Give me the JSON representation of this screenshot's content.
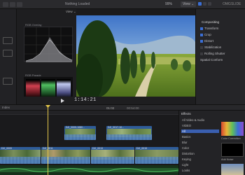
{
  "toolbar": {
    "library_title": "Nothing Loaded",
    "zoom": "99%",
    "view_menu": "View ⌄",
    "badge": "OMGSLIDE"
  },
  "scopes": {
    "view_label": "View ⌄",
    "rgb_overlay_label": "RGB Overlay",
    "rgb_parade_label": "RGB Parade",
    "parade": [
      "Red",
      "Green",
      "Blue"
    ]
  },
  "viewer": {
    "timecode": "1:14:21"
  },
  "inspector": {
    "section": "Compositing",
    "rows": [
      {
        "label": "Transform",
        "checked": true
      },
      {
        "label": "Crop",
        "checked": true
      },
      {
        "label": "Distort",
        "checked": true
      },
      {
        "label": "Stabilization",
        "checked": false
      },
      {
        "label": "Rolling Shutter",
        "checked": false
      },
      {
        "label": "Spatial Conform",
        "checked": false
      }
    ]
  },
  "timeline": {
    "index_label": "Index",
    "duration": "01:02",
    "total": "00:54:00",
    "clips": [
      {
        "label": "DJI_0009-1080...",
        "lane": "upper"
      },
      {
        "label": "DJI_0017-10...",
        "lane": "upper"
      },
      {
        "label": "DJI_0009",
        "lane": "main"
      },
      {
        "label": "DJI_0011",
        "lane": "main"
      },
      {
        "label": "DJI_0013",
        "lane": "main"
      },
      {
        "label": "DJI_0015",
        "lane": "main"
      }
    ]
  },
  "effects": {
    "header": "Effects",
    "categories": [
      "All Video & Audio",
      "VIDEO",
      "All",
      "Basics",
      "Blur",
      "Color",
      "Distortion",
      "Keying",
      "Light",
      "Looks"
    ],
    "selected_index": 2,
    "items": [
      "Color Correction",
      "Add Noise"
    ]
  },
  "colors": {
    "accent": "#3b6fd6",
    "playhead": "#e6c84a",
    "clip_blue": "#2f5d9a"
  }
}
